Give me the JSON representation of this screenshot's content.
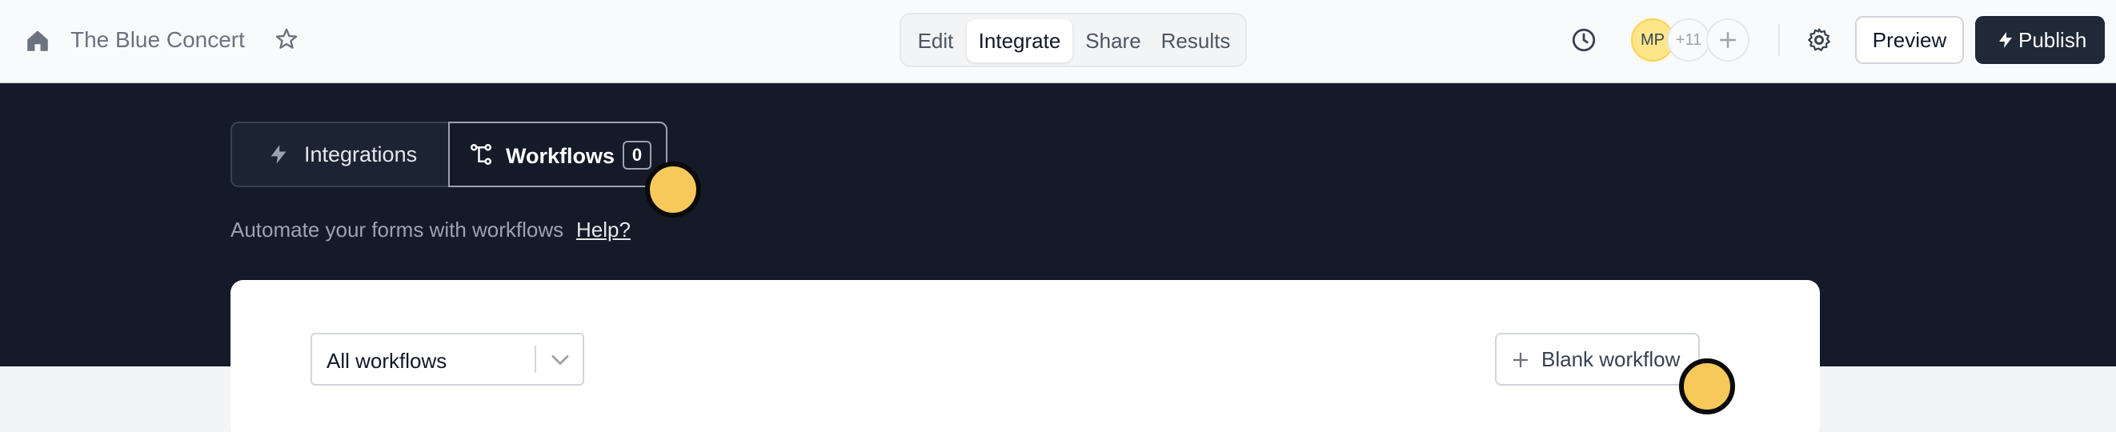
{
  "header": {
    "title": "The Blue Concert",
    "modes": [
      "Edit",
      "Integrate",
      "Share",
      "Results"
    ],
    "active_mode": "Integrate",
    "avatar_initials": "MP",
    "more_collaborators": "+11",
    "preview_label": "Preview",
    "publish_label": "Publish"
  },
  "tabs": {
    "integrations_label": "Integrations",
    "workflows_label": "Workflows",
    "workflows_count": "0",
    "active": "Workflows"
  },
  "intro": {
    "text": "Automate your forms with workflows",
    "help_link": "Help?"
  },
  "workflows_panel": {
    "filter_value": "All workflows",
    "blank_workflow_label": "Blank workflow"
  },
  "colors": {
    "band": "#141a28",
    "publish_bg": "#1f2937",
    "avatar_bg": "#fde68a",
    "cursor": "#f7c85a"
  },
  "icons": [
    "home-icon",
    "star-icon",
    "history-icon",
    "plus-icon",
    "gear-icon",
    "lightning-icon",
    "workflow-icon",
    "chevron-down-icon"
  ]
}
